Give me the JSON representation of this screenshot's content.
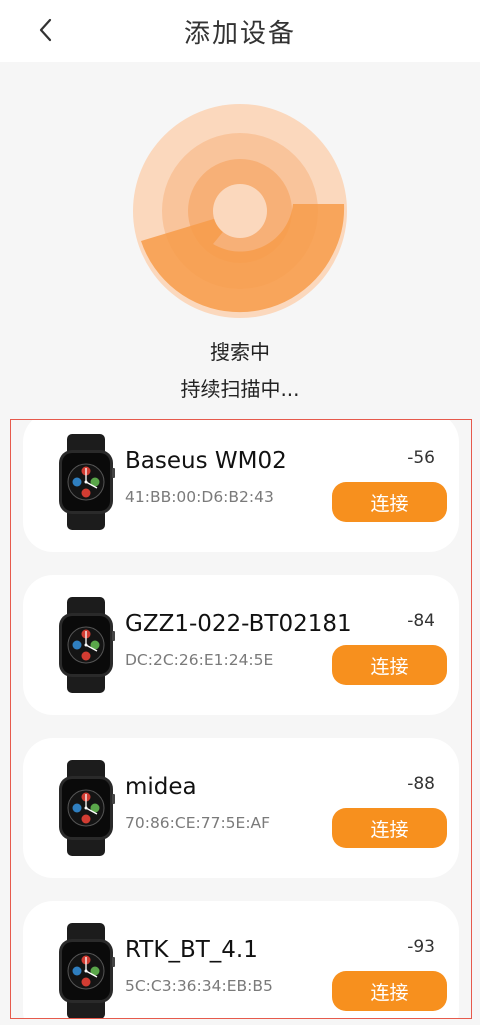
{
  "header": {
    "title": "添加设备",
    "back_icon": "chevron-left-icon"
  },
  "scan": {
    "status_primary": "搜索中",
    "status_secondary": "持续扫描中...",
    "radar_color": "#f7901e"
  },
  "devices": [
    {
      "name": "Baseus WM02",
      "mac": "41:BB:00:D6:B2:43",
      "rssi": "-56",
      "action": "连接",
      "icon": "smartwatch-icon"
    },
    {
      "name": "GZZ1-022-BT02181",
      "mac": "DC:2C:26:E1:24:5E",
      "rssi": "-84",
      "action": "连接",
      "icon": "smartwatch-icon"
    },
    {
      "name": "midea",
      "mac": "70:86:CE:77:5E:AF",
      "rssi": "-88",
      "action": "连接",
      "icon": "smartwatch-icon"
    },
    {
      "name": "RTK_BT_4.1",
      "mac": "5C:C3:36:34:EB:B5",
      "rssi": "-93",
      "action": "连接",
      "icon": "smartwatch-icon"
    }
  ],
  "colors": {
    "accent": "#f7901e",
    "frame": "#e65a4c",
    "background": "#f6f6f6"
  }
}
